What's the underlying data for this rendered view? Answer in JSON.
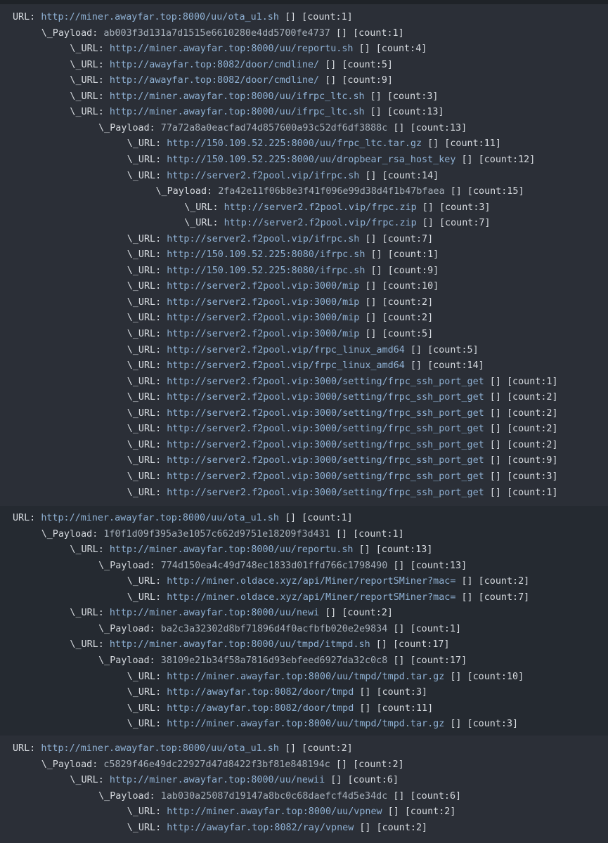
{
  "blocks": [
    {
      "lines": [
        {
          "depth": 0,
          "kind": "url",
          "value": "http://miner.awayfar.top:8000/uu/ota_u1.sh",
          "count": "1"
        },
        {
          "depth": 1,
          "kind": "payload",
          "value": "ab003f3d131a7d1515e6610280e4dd5700fe4737",
          "count": "1"
        },
        {
          "depth": 2,
          "kind": "url",
          "value": "http://miner.awayfar.top:8000/uu/reportu.sh",
          "count": "4"
        },
        {
          "depth": 2,
          "kind": "url",
          "value": "http://awayfar.top:8082/door/cmdline/",
          "count": "5"
        },
        {
          "depth": 2,
          "kind": "url",
          "value": "http://awayfar.top:8082/door/cmdline/",
          "count": "9"
        },
        {
          "depth": 2,
          "kind": "url",
          "value": "http://miner.awayfar.top:8000/uu/ifrpc_ltc.sh",
          "count": "3"
        },
        {
          "depth": 2,
          "kind": "url",
          "value": "http://miner.awayfar.top:8000/uu/ifrpc_ltc.sh",
          "count": "13"
        },
        {
          "depth": 3,
          "kind": "payload",
          "value": "77a72a8a0eacfad74d857600a93c52df6df3888c",
          "count": "13"
        },
        {
          "depth": 4,
          "kind": "url",
          "value": "http://150.109.52.225:8000/uu/frpc_ltc.tar.gz",
          "count": "11"
        },
        {
          "depth": 4,
          "kind": "url",
          "value": "http://150.109.52.225:8000/uu/dropbear_rsa_host_key",
          "count": "12"
        },
        {
          "depth": 4,
          "kind": "url",
          "value": "http://server2.f2pool.vip/ifrpc.sh",
          "count": "14"
        },
        {
          "depth": 5,
          "kind": "payload",
          "value": "2fa42e11f06b8e3f41f096e99d38d4f1b47bfaea",
          "count": "15"
        },
        {
          "depth": 6,
          "kind": "url",
          "value": "http://server2.f2pool.vip/frpc.zip",
          "count": "3"
        },
        {
          "depth": 6,
          "kind": "url",
          "value": "http://server2.f2pool.vip/frpc.zip",
          "count": "7"
        },
        {
          "depth": 4,
          "kind": "url",
          "value": "http://server2.f2pool.vip/ifrpc.sh",
          "count": "7"
        },
        {
          "depth": 4,
          "kind": "url",
          "value": "http://150.109.52.225:8080/ifrpc.sh",
          "count": "1"
        },
        {
          "depth": 4,
          "kind": "url",
          "value": "http://150.109.52.225:8080/ifrpc.sh",
          "count": "9"
        },
        {
          "depth": 4,
          "kind": "url",
          "value": "http://server2.f2pool.vip:3000/mip",
          "count": "10"
        },
        {
          "depth": 4,
          "kind": "url",
          "value": "http://server2.f2pool.vip:3000/mip",
          "count": "2"
        },
        {
          "depth": 4,
          "kind": "url",
          "value": "http://server2.f2pool.vip:3000/mip",
          "count": "2"
        },
        {
          "depth": 4,
          "kind": "url",
          "value": "http://server2.f2pool.vip:3000/mip",
          "count": "5"
        },
        {
          "depth": 4,
          "kind": "url",
          "value": "http://server2.f2pool.vip/frpc_linux_amd64",
          "count": "5"
        },
        {
          "depth": 4,
          "kind": "url",
          "value": "http://server2.f2pool.vip/frpc_linux_amd64",
          "count": "14"
        },
        {
          "depth": 4,
          "kind": "url",
          "value": "http://server2.f2pool.vip:3000/setting/frpc_ssh_port_get",
          "count": "1"
        },
        {
          "depth": 4,
          "kind": "url",
          "value": "http://server2.f2pool.vip:3000/setting/frpc_ssh_port_get",
          "count": "2"
        },
        {
          "depth": 4,
          "kind": "url",
          "value": "http://server2.f2pool.vip:3000/setting/frpc_ssh_port_get",
          "count": "2"
        },
        {
          "depth": 4,
          "kind": "url",
          "value": "http://server2.f2pool.vip:3000/setting/frpc_ssh_port_get",
          "count": "2"
        },
        {
          "depth": 4,
          "kind": "url",
          "value": "http://server2.f2pool.vip:3000/setting/frpc_ssh_port_get",
          "count": "2"
        },
        {
          "depth": 4,
          "kind": "url",
          "value": "http://server2.f2pool.vip:3000/setting/frpc_ssh_port_get",
          "count": "9"
        },
        {
          "depth": 4,
          "kind": "url",
          "value": "http://server2.f2pool.vip:3000/setting/frpc_ssh_port_get",
          "count": "3"
        },
        {
          "depth": 4,
          "kind": "url",
          "value": "http://server2.f2pool.vip:3000/setting/frpc_ssh_port_get",
          "count": "1"
        }
      ]
    },
    {
      "lines": [
        {
          "depth": 0,
          "kind": "url",
          "value": "http://miner.awayfar.top:8000/uu/ota_u1.sh",
          "count": "1"
        },
        {
          "depth": 1,
          "kind": "payload",
          "value": "1f0f1d09f395a3e1057c662d9751e18209f3d431",
          "count": "1"
        },
        {
          "depth": 2,
          "kind": "url",
          "value": "http://miner.awayfar.top:8000/uu/reportu.sh",
          "count": "13"
        },
        {
          "depth": 3,
          "kind": "payload",
          "value": "774d150ea4c49d748ec1833d01ffd766c1798490",
          "count": "13"
        },
        {
          "depth": 4,
          "kind": "url",
          "value": "http://miner.oldace.xyz/api/Miner/reportSMiner?mac=",
          "count": "2"
        },
        {
          "depth": 4,
          "kind": "url",
          "value": "http://miner.oldace.xyz/api/Miner/reportSMiner?mac=",
          "count": "7"
        },
        {
          "depth": 2,
          "kind": "url",
          "value": "http://miner.awayfar.top:8000/uu/newi",
          "count": "2"
        },
        {
          "depth": 3,
          "kind": "payload",
          "value": "ba2c3a32302d8bf71896d4f0acfbfb020e2e9834",
          "count": "1"
        },
        {
          "depth": 2,
          "kind": "url",
          "value": "http://miner.awayfar.top:8000/uu/tmpd/itmpd.sh",
          "count": "17"
        },
        {
          "depth": 3,
          "kind": "payload",
          "value": "38109e21b34f58a7816d93ebfeed6927da32c0c8",
          "count": "17"
        },
        {
          "depth": 4,
          "kind": "url",
          "value": "http://miner.awayfar.top:8000/uu/tmpd/tmpd.tar.gz",
          "count": "10"
        },
        {
          "depth": 4,
          "kind": "url",
          "value": "http://awayfar.top:8082/door/tmpd",
          "count": "3"
        },
        {
          "depth": 4,
          "kind": "url",
          "value": "http://awayfar.top:8082/door/tmpd",
          "count": "11"
        },
        {
          "depth": 4,
          "kind": "url",
          "value": "http://miner.awayfar.top:8000/uu/tmpd/tmpd.tar.gz",
          "count": "3"
        }
      ]
    },
    {
      "lines": [
        {
          "depth": 0,
          "kind": "url",
          "value": "http://miner.awayfar.top:8000/uu/ota_u1.sh",
          "count": "2"
        },
        {
          "depth": 1,
          "kind": "payload",
          "value": "c5829f46e49dc22927d47d8422f3bf81e848194c",
          "count": "2"
        },
        {
          "depth": 2,
          "kind": "url",
          "value": "http://miner.awayfar.top:8000/uu/newii",
          "count": "6"
        },
        {
          "depth": 3,
          "kind": "payload",
          "value": "1ab030a25087d19147a8bc0c68daefcf4d5e34dc",
          "count": "6"
        },
        {
          "depth": 4,
          "kind": "url",
          "value": "http://miner.awayfar.top:8000/uu/vpnew",
          "count": "2"
        },
        {
          "depth": 4,
          "kind": "url",
          "value": "http://awayfar.top:8082/ray/vpnew",
          "count": "2"
        }
      ]
    }
  ],
  "labels": {
    "root_url": "URL: ",
    "child_url": "\\_URL: ",
    "payload": "\\_Payload: ",
    "brackets": " [] ",
    "count_prefix": "[count:",
    "count_suffix": "]"
  },
  "colors": {
    "background": "#22262d",
    "block_a": "#2b2f37",
    "block_b": "#252a31",
    "url_text": "#8fb1d4",
    "plain_text": "#d7dbe0"
  }
}
